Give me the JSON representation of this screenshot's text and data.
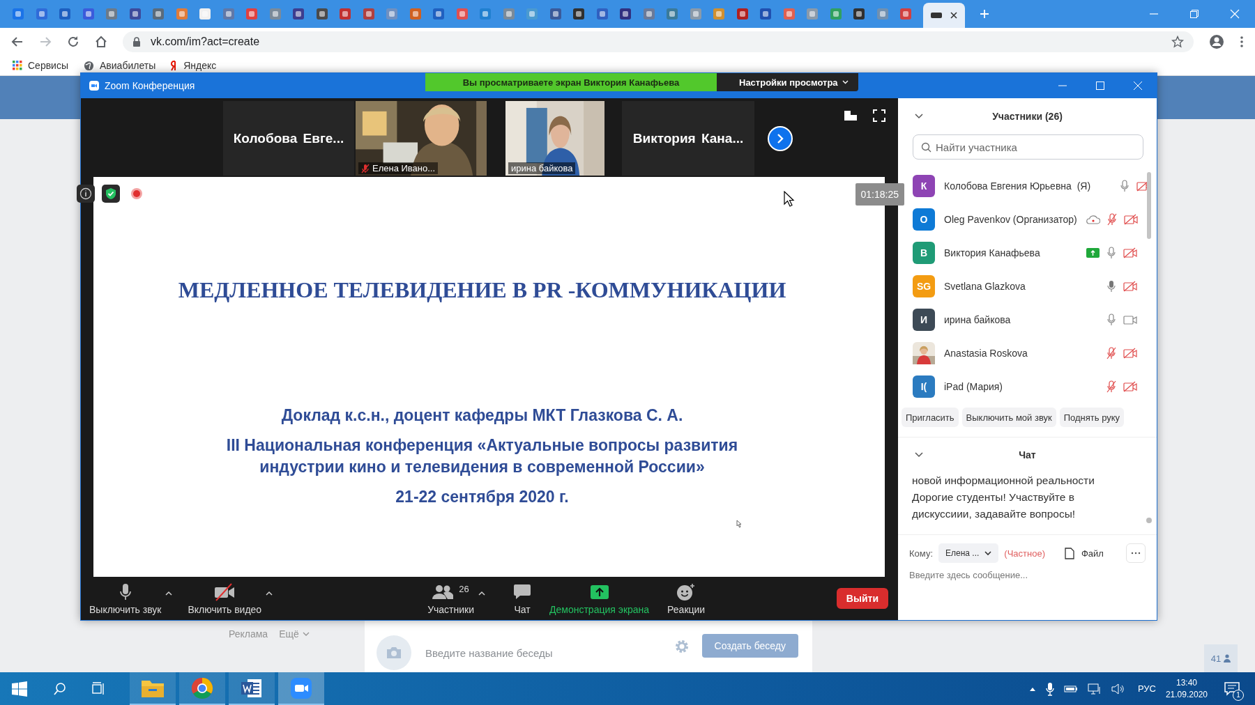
{
  "browser": {
    "url": "vk.com/im?act=create",
    "bookmarks": [
      {
        "kind": "apps",
        "label": "Сервисы"
      },
      {
        "kind": "globe",
        "label": "Авиабилеты"
      },
      {
        "kind": "yandex",
        "label": "Яндекс"
      }
    ]
  },
  "vk_page": {
    "links": [
      {
        "label": "Реклама",
        "caret": false
      },
      {
        "label": "Ещё",
        "caret": true
      }
    ],
    "chat_name": {
      "placeholder": "Введите название беседы"
    },
    "create_button": "Создать беседу",
    "counter": "41"
  },
  "zoom": {
    "title": "Zoom Конференция",
    "banner": "Вы просматриваете экран Виктория Канафьева",
    "view_options": "Настройки просмотра",
    "thumbnails": [
      {
        "kind": "name",
        "name": "Колобова Евге..."
      },
      {
        "kind": "video",
        "name": "Елена Ивано...",
        "muted": true
      },
      {
        "kind": "video",
        "name": "ирина байкова",
        "muted": false
      },
      {
        "kind": "name",
        "name": "Виктория Кана..."
      }
    ],
    "timer": "01:18:25",
    "slide": {
      "title": "МЕДЛЕННОЕ ТЕЛЕВИДЕНИЕ В PR -КОММУНИКАЦИИ",
      "author": "Доклад к.с.н., доцент кафедры МКТ Глазкова С. А.",
      "conference": "III Национальная конференция «Актуальные вопросы развития индустрии кино и телевидения в современной России»",
      "dates": "21-22 сентября 2020 г."
    },
    "toolbar": [
      {
        "kind": "mic",
        "label": "Выключить звук",
        "caret": true
      },
      {
        "kind": "video_off",
        "label": "Включить видео",
        "caret": true
      },
      {
        "kind": "participants",
        "label": "Участники",
        "count": "26",
        "caret": true
      },
      {
        "kind": "chat",
        "label": "Чат",
        "caret": false
      },
      {
        "kind": "share",
        "label": "Демонстрация экрана",
        "caret": false
      },
      {
        "kind": "reactions",
        "label": "Реакции",
        "caret": false
      }
    ],
    "leave": "Выйти"
  },
  "participants": {
    "title": "Участники (26)",
    "search": {
      "placeholder": "Найти участника"
    },
    "items": [
      {
        "initials": "К",
        "color": "#8e44b4",
        "name": "Колобова Евгения Юрьевна",
        "tag": "(Я)",
        "recording": false,
        "sharing": false,
        "muted": false,
        "speaking": false,
        "video_off": true
      },
      {
        "initials": "O",
        "color": "#0e7ad6",
        "name": "Oleg Pavenkov (Организатор)",
        "recording": true,
        "sharing": false,
        "muted": true,
        "speaking": false,
        "video_off": true
      },
      {
        "initials": "В",
        "color": "#1f9b76",
        "name": "Виктория Канафьева",
        "recording": false,
        "sharing": true,
        "muted": false,
        "speaking": false,
        "video_off": true
      },
      {
        "initials": "SG",
        "color": "#f39c12",
        "name": "Svetlana Glazkova",
        "recording": false,
        "sharing": false,
        "muted": false,
        "speaking": true,
        "video_off": true
      },
      {
        "initials": "И",
        "color": "#3d4a56",
        "name": "ирина байкова",
        "recording": false,
        "sharing": false,
        "muted": false,
        "speaking": false,
        "video_off": false
      },
      {
        "kind": "picture",
        "name": "Anastasia Roskova",
        "recording": false,
        "sharing": false,
        "muted": true,
        "speaking": false,
        "video_off": true
      },
      {
        "initials": "I(",
        "color": "#2b7bc0",
        "name": "iPad (Мария)",
        "recording": false,
        "sharing": false,
        "muted": true,
        "speaking": false,
        "video_off": true
      }
    ],
    "buttons": [
      "Пригласить",
      "Выключить мой звук",
      "Поднять руку"
    ]
  },
  "chat": {
    "title": "Чат",
    "messages": [
      "новой информационной реальности",
      "Дорогие студенты! Участвуйте в дискуссиии, задавайте вопросы!"
    ],
    "to_label": "Кому:",
    "recipient": "Елена ...",
    "private": "(Частное)",
    "file": "Файл",
    "input": {
      "placeholder": "Введите здесь сообщение..."
    }
  },
  "taskbar": {
    "language": "РУС",
    "time": "13:40",
    "date": "21.09.2020",
    "notifications": "1"
  }
}
